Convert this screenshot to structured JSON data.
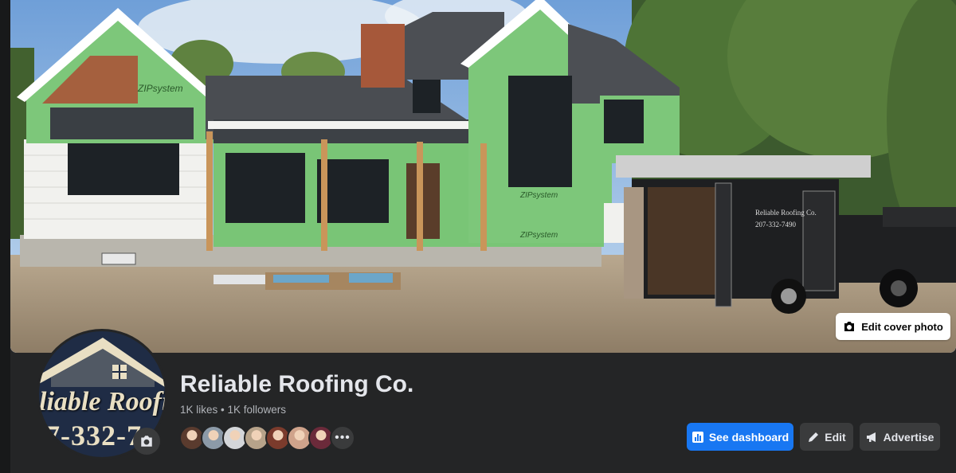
{
  "cover": {
    "edit_label": "Edit cover photo",
    "trailer_logo_text": "Reliable Roofing Co.",
    "trailer_phone": "207-332-7490",
    "wrap_text": "ZIPsystem"
  },
  "profile": {
    "avatar_text": "liable Roofing",
    "avatar_phone": "7-332-7",
    "name": "Reliable Roofing Co.",
    "stats": "1K likes • 1K followers",
    "follower_avatars": [
      "#5a3b2e",
      "#8c9aa8",
      "#d4d6d9",
      "#b7a38a",
      "#7b3b2c",
      "#cfa38b",
      "#6b2a3a"
    ],
    "more_label": "•••"
  },
  "actions": {
    "dashboard_label": "See dashboard",
    "edit_label": "Edit",
    "advertise_label": "Advertise"
  },
  "colors": {
    "accent": "#1877f2",
    "panel": "#242526",
    "button": "#3a3b3c",
    "wrap_green": "#7dc77a"
  },
  "icons": [
    "camera-icon",
    "chart-icon",
    "pencil-icon",
    "megaphone-icon"
  ]
}
